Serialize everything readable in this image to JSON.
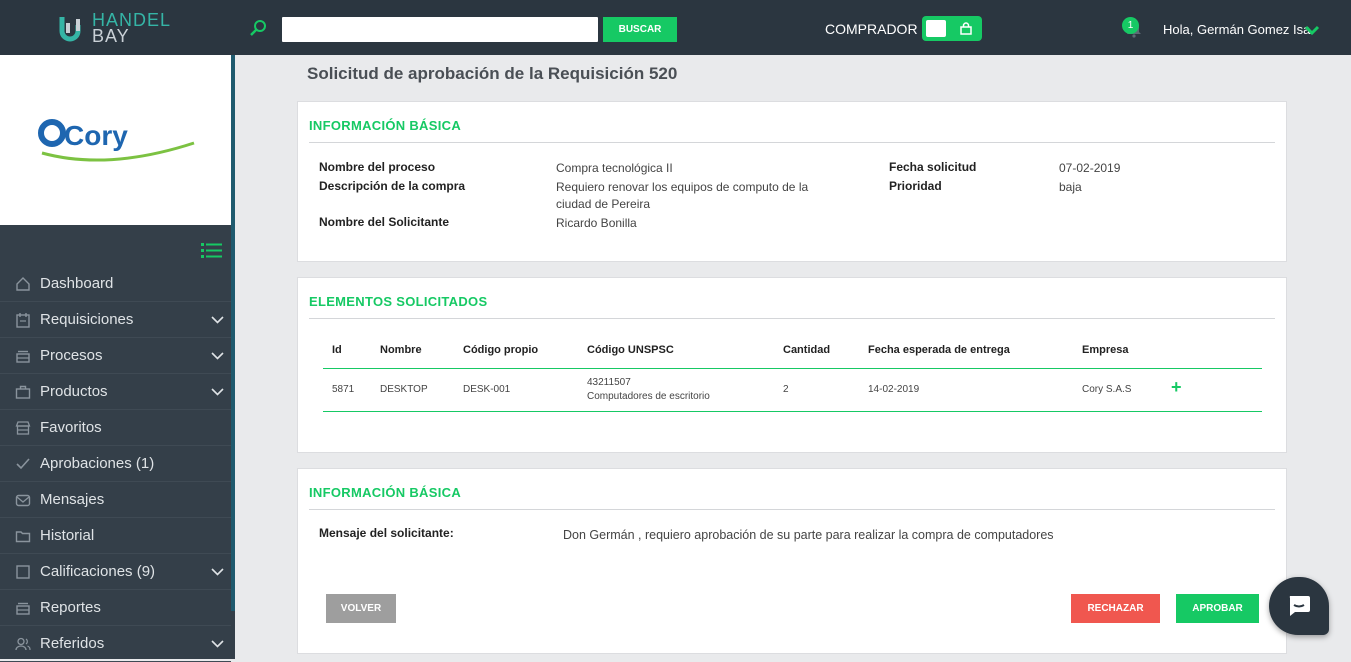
{
  "header": {
    "logo_line1": "HANDEL",
    "logo_line2": "BAY",
    "search_placeholder": "",
    "search_button": "BUSCAR",
    "mode_label": "COMPRADOR",
    "notification_count": "1",
    "greeting": "Hola, Germán Gomez Isa"
  },
  "sidebar": {
    "company_logo_text": "Cory",
    "items": [
      {
        "label": "Dashboard",
        "icon": "home-icon",
        "has_submenu": false
      },
      {
        "label": "Requisiciones",
        "icon": "clipboard-icon",
        "has_submenu": true
      },
      {
        "label": "Procesos",
        "icon": "stack-icon",
        "has_submenu": true
      },
      {
        "label": "Productos",
        "icon": "briefcase-icon",
        "has_submenu": true
      },
      {
        "label": "Favoritos",
        "icon": "store-icon",
        "has_submenu": false
      },
      {
        "label": "Aprobaciones (1)",
        "icon": "check-icon",
        "has_submenu": false
      },
      {
        "label": "Mensajes",
        "icon": "envelope-icon",
        "has_submenu": false
      },
      {
        "label": "Historial",
        "icon": "folder-icon",
        "has_submenu": false
      },
      {
        "label": "Calificaciones (9)",
        "icon": "square-icon",
        "has_submenu": true
      },
      {
        "label": "Reportes",
        "icon": "stack-icon",
        "has_submenu": false
      },
      {
        "label": "Referidos",
        "icon": "users-icon",
        "has_submenu": true
      }
    ]
  },
  "page": {
    "title": "Solicitud de aprobación de la Requisición 520"
  },
  "basic_info": {
    "title": "INFORMACIÓN BÁSICA",
    "process_name_label": "Nombre del proceso",
    "process_name": "Compra tecnológica II",
    "description_label": "Descripción de la compra",
    "description_line1": "Requiero renovar los equipos de computo de la",
    "description_line2": "ciudad de Pereira",
    "requester_label": "Nombre del Solicitante",
    "requester": "Ricardo Bonilla",
    "date_label": "Fecha solicitud",
    "date": "07-02-2019",
    "priority_label": "Prioridad",
    "priority": "baja"
  },
  "items": {
    "title": "ELEMENTOS SOLICITADOS",
    "columns": [
      "Id",
      "Nombre",
      "Código propio",
      "Código UNSPSC",
      "Cantidad",
      "Fecha esperada de entrega",
      "Empresa"
    ],
    "rows": [
      {
        "id": "5871",
        "nombre": "DESKTOP",
        "codigo_propio": "DESK-001",
        "unspsc_code": "43211507",
        "unspsc_desc": "Computadores de escritorio",
        "cantidad": "2",
        "fecha": "14-02-2019",
        "empresa": "Cory S.A.S"
      }
    ],
    "add_symbol": "+"
  },
  "message_section": {
    "title": "INFORMACIÓN BÁSICA",
    "message_label": "Mensaje del solicitante:",
    "message": "Don Germán , requiero aprobación de su parte para realizar la compra de computadores",
    "back_button": "VOLVER",
    "reject_button": "RECHAZAR",
    "approve_button": "APROBAR"
  },
  "colors": {
    "accent": "#16c964",
    "topbar": "#2b3640",
    "sidebar": "#343f49",
    "reject": "#f0574f",
    "back": "#9e9e9e"
  }
}
